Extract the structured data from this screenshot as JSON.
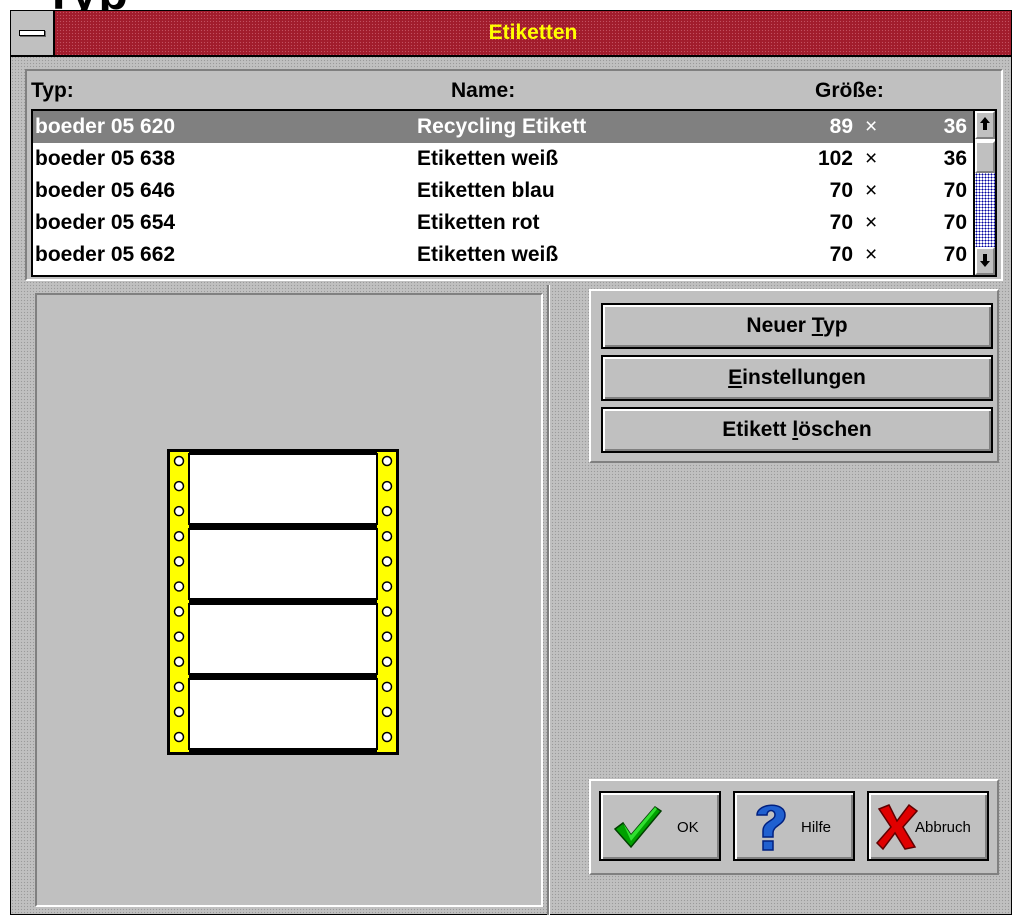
{
  "background_fragment": "Typ",
  "window": {
    "title": "Etiketten",
    "colors": {
      "titlebar": "#a11c2c",
      "title_text": "#ffff00",
      "selection": "#808080",
      "label_strip": "#ffff00"
    }
  },
  "list": {
    "headers": {
      "typ": "Typ:",
      "name": "Name:",
      "size": "Größe:"
    },
    "rows": [
      {
        "typ": "boeder 05 620",
        "name": "Recycling Etikett",
        "w": "89",
        "x": "×",
        "h": "36",
        "selected": true
      },
      {
        "typ": "boeder 05 638",
        "name": "Etiketten weiß",
        "w": "102",
        "x": "×",
        "h": "36",
        "selected": false
      },
      {
        "typ": "boeder 05 646",
        "name": "Etiketten blau",
        "w": "70",
        "x": "×",
        "h": "70",
        "selected": false
      },
      {
        "typ": "boeder 05 654",
        "name": "Etiketten rot",
        "w": "70",
        "x": "×",
        "h": "70",
        "selected": false
      },
      {
        "typ": "boeder 05 662",
        "name": "Etiketten weiß",
        "w": "70",
        "x": "×",
        "h": "70",
        "selected": false
      }
    ],
    "scrollbar": {
      "up_icon": "arrow-up-icon",
      "down_icon": "arrow-down-icon"
    }
  },
  "preview": {
    "label_count": 4,
    "holes_per_side": 12
  },
  "actions": {
    "new_type": {
      "pre": "Neuer ",
      "key": "T",
      "post": "yp"
    },
    "settings": {
      "pre": "",
      "key": "E",
      "post": "instellungen"
    },
    "delete": {
      "pre": "Etikett ",
      "key": "l",
      "post": "öschen"
    }
  },
  "dialog_buttons": {
    "ok": {
      "label": "OK",
      "icon": "checkmark-icon"
    },
    "help": {
      "label": "Hilfe",
      "icon": "question-mark-icon"
    },
    "cancel": {
      "label": "Abbruch",
      "icon": "red-x-icon"
    }
  }
}
